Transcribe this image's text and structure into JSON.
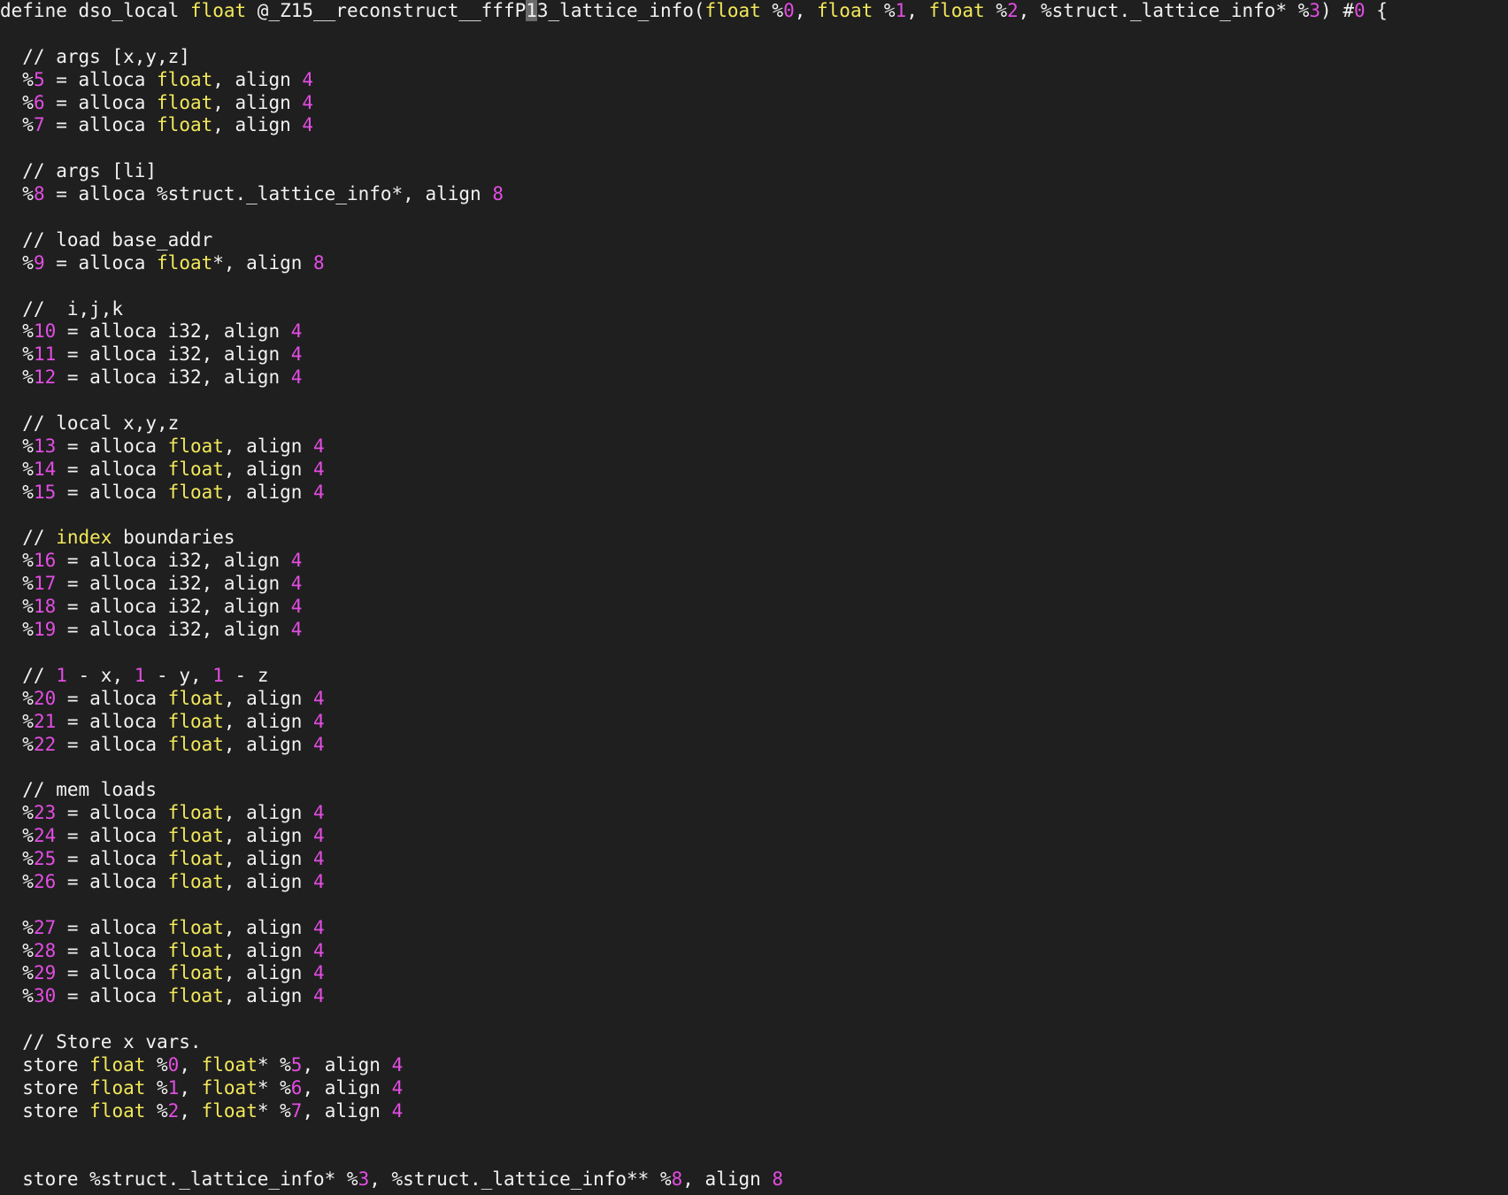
{
  "editor": {
    "colors": {
      "background": "#1f1f1f",
      "text": "#f2f2f2",
      "type": "#f2e85a",
      "number": "#e34de3",
      "cursor": "#6a6a6a"
    },
    "lines": [
      [
        [
          "p",
          "define dso_local "
        ],
        [
          "t",
          "float"
        ],
        [
          "p",
          " @_Z15__reconstruct__fffP"
        ],
        [
          "c",
          "1"
        ],
        [
          "p",
          "3_lattice_info("
        ],
        [
          "t",
          "float"
        ],
        [
          "p",
          " %"
        ],
        [
          "n",
          "0"
        ],
        [
          "p",
          ", "
        ],
        [
          "t",
          "float"
        ],
        [
          "p",
          " %"
        ],
        [
          "n",
          "1"
        ],
        [
          "p",
          ", "
        ],
        [
          "t",
          "float"
        ],
        [
          "p",
          " %"
        ],
        [
          "n",
          "2"
        ],
        [
          "p",
          ", %struct._lattice_info* %"
        ],
        [
          "n",
          "3"
        ],
        [
          "p",
          ") #"
        ],
        [
          "n",
          "0"
        ],
        [
          "p",
          " {"
        ]
      ],
      [],
      [
        [
          "p",
          "  // args [x,y,z]"
        ]
      ],
      [
        [
          "p",
          "  %"
        ],
        [
          "n",
          "5"
        ],
        [
          "p",
          " = alloca "
        ],
        [
          "t",
          "float"
        ],
        [
          "p",
          ", align "
        ],
        [
          "n",
          "4"
        ]
      ],
      [
        [
          "p",
          "  %"
        ],
        [
          "n",
          "6"
        ],
        [
          "p",
          " = alloca "
        ],
        [
          "t",
          "float"
        ],
        [
          "p",
          ", align "
        ],
        [
          "n",
          "4"
        ]
      ],
      [
        [
          "p",
          "  %"
        ],
        [
          "n",
          "7"
        ],
        [
          "p",
          " = alloca "
        ],
        [
          "t",
          "float"
        ],
        [
          "p",
          ", align "
        ],
        [
          "n",
          "4"
        ]
      ],
      [],
      [
        [
          "p",
          "  // args [li]"
        ]
      ],
      [
        [
          "p",
          "  %"
        ],
        [
          "n",
          "8"
        ],
        [
          "p",
          " = alloca %struct._lattice_info*, align "
        ],
        [
          "n",
          "8"
        ]
      ],
      [],
      [
        [
          "p",
          "  // load base_addr"
        ]
      ],
      [
        [
          "p",
          "  %"
        ],
        [
          "n",
          "9"
        ],
        [
          "p",
          " = alloca "
        ],
        [
          "t",
          "float"
        ],
        [
          "p",
          "*, align "
        ],
        [
          "n",
          "8"
        ]
      ],
      [],
      [
        [
          "p",
          "  //  i,j,k"
        ]
      ],
      [
        [
          "p",
          "  %"
        ],
        [
          "n",
          "10"
        ],
        [
          "p",
          " = alloca i32, align "
        ],
        [
          "n",
          "4"
        ]
      ],
      [
        [
          "p",
          "  %"
        ],
        [
          "n",
          "11"
        ],
        [
          "p",
          " = alloca i32, align "
        ],
        [
          "n",
          "4"
        ]
      ],
      [
        [
          "p",
          "  %"
        ],
        [
          "n",
          "12"
        ],
        [
          "p",
          " = alloca i32, align "
        ],
        [
          "n",
          "4"
        ]
      ],
      [],
      [
        [
          "p",
          "  // local x,y,z"
        ]
      ],
      [
        [
          "p",
          "  %"
        ],
        [
          "n",
          "13"
        ],
        [
          "p",
          " = alloca "
        ],
        [
          "t",
          "float"
        ],
        [
          "p",
          ", align "
        ],
        [
          "n",
          "4"
        ]
      ],
      [
        [
          "p",
          "  %"
        ],
        [
          "n",
          "14"
        ],
        [
          "p",
          " = alloca "
        ],
        [
          "t",
          "float"
        ],
        [
          "p",
          ", align "
        ],
        [
          "n",
          "4"
        ]
      ],
      [
        [
          "p",
          "  %"
        ],
        [
          "n",
          "15"
        ],
        [
          "p",
          " = alloca "
        ],
        [
          "t",
          "float"
        ],
        [
          "p",
          ", align "
        ],
        [
          "n",
          "4"
        ]
      ],
      [],
      [
        [
          "p",
          "  // "
        ],
        [
          "t",
          "index"
        ],
        [
          "p",
          " boundaries"
        ]
      ],
      [
        [
          "p",
          "  %"
        ],
        [
          "n",
          "16"
        ],
        [
          "p",
          " = alloca i32, align "
        ],
        [
          "n",
          "4"
        ]
      ],
      [
        [
          "p",
          "  %"
        ],
        [
          "n",
          "17"
        ],
        [
          "p",
          " = alloca i32, align "
        ],
        [
          "n",
          "4"
        ]
      ],
      [
        [
          "p",
          "  %"
        ],
        [
          "n",
          "18"
        ],
        [
          "p",
          " = alloca i32, align "
        ],
        [
          "n",
          "4"
        ]
      ],
      [
        [
          "p",
          "  %"
        ],
        [
          "n",
          "19"
        ],
        [
          "p",
          " = alloca i32, align "
        ],
        [
          "n",
          "4"
        ]
      ],
      [],
      [
        [
          "p",
          "  // "
        ],
        [
          "n",
          "1"
        ],
        [
          "p",
          " - x, "
        ],
        [
          "n",
          "1"
        ],
        [
          "p",
          " - y, "
        ],
        [
          "n",
          "1"
        ],
        [
          "p",
          " - z"
        ]
      ],
      [
        [
          "p",
          "  %"
        ],
        [
          "n",
          "20"
        ],
        [
          "p",
          " = alloca "
        ],
        [
          "t",
          "float"
        ],
        [
          "p",
          ", align "
        ],
        [
          "n",
          "4"
        ]
      ],
      [
        [
          "p",
          "  %"
        ],
        [
          "n",
          "21"
        ],
        [
          "p",
          " = alloca "
        ],
        [
          "t",
          "float"
        ],
        [
          "p",
          ", align "
        ],
        [
          "n",
          "4"
        ]
      ],
      [
        [
          "p",
          "  %"
        ],
        [
          "n",
          "22"
        ],
        [
          "p",
          " = alloca "
        ],
        [
          "t",
          "float"
        ],
        [
          "p",
          ", align "
        ],
        [
          "n",
          "4"
        ]
      ],
      [],
      [
        [
          "p",
          "  // mem loads"
        ]
      ],
      [
        [
          "p",
          "  %"
        ],
        [
          "n",
          "23"
        ],
        [
          "p",
          " = alloca "
        ],
        [
          "t",
          "float"
        ],
        [
          "p",
          ", align "
        ],
        [
          "n",
          "4"
        ]
      ],
      [
        [
          "p",
          "  %"
        ],
        [
          "n",
          "24"
        ],
        [
          "p",
          " = alloca "
        ],
        [
          "t",
          "float"
        ],
        [
          "p",
          ", align "
        ],
        [
          "n",
          "4"
        ]
      ],
      [
        [
          "p",
          "  %"
        ],
        [
          "n",
          "25"
        ],
        [
          "p",
          " = alloca "
        ],
        [
          "t",
          "float"
        ],
        [
          "p",
          ", align "
        ],
        [
          "n",
          "4"
        ]
      ],
      [
        [
          "p",
          "  %"
        ],
        [
          "n",
          "26"
        ],
        [
          "p",
          " = alloca "
        ],
        [
          "t",
          "float"
        ],
        [
          "p",
          ", align "
        ],
        [
          "n",
          "4"
        ]
      ],
      [],
      [
        [
          "p",
          "  %"
        ],
        [
          "n",
          "27"
        ],
        [
          "p",
          " = alloca "
        ],
        [
          "t",
          "float"
        ],
        [
          "p",
          ", align "
        ],
        [
          "n",
          "4"
        ]
      ],
      [
        [
          "p",
          "  %"
        ],
        [
          "n",
          "28"
        ],
        [
          "p",
          " = alloca "
        ],
        [
          "t",
          "float"
        ],
        [
          "p",
          ", align "
        ],
        [
          "n",
          "4"
        ]
      ],
      [
        [
          "p",
          "  %"
        ],
        [
          "n",
          "29"
        ],
        [
          "p",
          " = alloca "
        ],
        [
          "t",
          "float"
        ],
        [
          "p",
          ", align "
        ],
        [
          "n",
          "4"
        ]
      ],
      [
        [
          "p",
          "  %"
        ],
        [
          "n",
          "30"
        ],
        [
          "p",
          " = alloca "
        ],
        [
          "t",
          "float"
        ],
        [
          "p",
          ", align "
        ],
        [
          "n",
          "4"
        ]
      ],
      [],
      [
        [
          "p",
          "  // Store x vars."
        ]
      ],
      [
        [
          "p",
          "  store "
        ],
        [
          "t",
          "float"
        ],
        [
          "p",
          " %"
        ],
        [
          "n",
          "0"
        ],
        [
          "p",
          ", "
        ],
        [
          "t",
          "float"
        ],
        [
          "p",
          "* %"
        ],
        [
          "n",
          "5"
        ],
        [
          "p",
          ", align "
        ],
        [
          "n",
          "4"
        ]
      ],
      [
        [
          "p",
          "  store "
        ],
        [
          "t",
          "float"
        ],
        [
          "p",
          " %"
        ],
        [
          "n",
          "1"
        ],
        [
          "p",
          ", "
        ],
        [
          "t",
          "float"
        ],
        [
          "p",
          "* %"
        ],
        [
          "n",
          "6"
        ],
        [
          "p",
          ", align "
        ],
        [
          "n",
          "4"
        ]
      ],
      [
        [
          "p",
          "  store "
        ],
        [
          "t",
          "float"
        ],
        [
          "p",
          " %"
        ],
        [
          "n",
          "2"
        ],
        [
          "p",
          ", "
        ],
        [
          "t",
          "float"
        ],
        [
          "p",
          "* %"
        ],
        [
          "n",
          "7"
        ],
        [
          "p",
          ", align "
        ],
        [
          "n",
          "4"
        ]
      ],
      [],
      [],
      [
        [
          "p",
          "  store %struct._lattice_info* %"
        ],
        [
          "n",
          "3"
        ],
        [
          "p",
          ", %struct._lattice_info** %"
        ],
        [
          "n",
          "8"
        ],
        [
          "p",
          ", align "
        ],
        [
          "n",
          "8"
        ]
      ]
    ]
  }
}
